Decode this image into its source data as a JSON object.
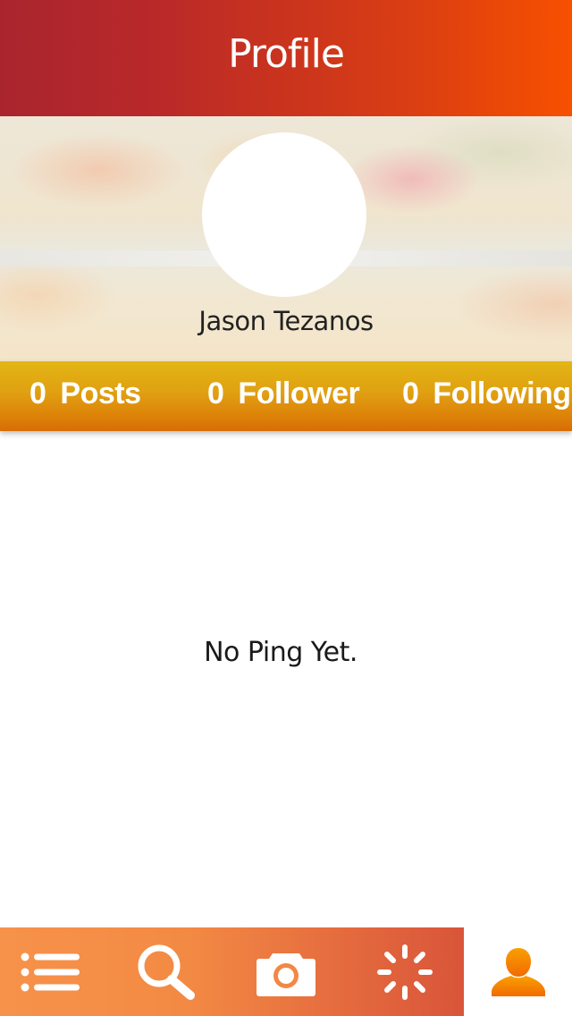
{
  "header": {
    "title": "Profile"
  },
  "profile": {
    "name": "Jason Tezanos"
  },
  "stats": {
    "posts": {
      "count": "0",
      "label": "Posts"
    },
    "follower": {
      "count": "0",
      "label": "Follower"
    },
    "following": {
      "count": "0",
      "label": "Following"
    }
  },
  "main": {
    "empty_message": "No Ping Yet."
  },
  "tabbar": {
    "items": [
      {
        "icon": "list-icon",
        "selected": false
      },
      {
        "icon": "search-icon",
        "selected": false
      },
      {
        "icon": "camera-icon",
        "selected": false
      },
      {
        "icon": "activity-spinner-icon",
        "selected": false
      },
      {
        "icon": "user-icon",
        "selected": true
      }
    ]
  },
  "colors": {
    "header_start": "#a9252e",
    "header_end": "#f75000",
    "stats_bar": "#e0a012",
    "tabbar_start": "#f7924a",
    "tabbar_end": "#d9553a",
    "active_icon": "#f57a00"
  }
}
